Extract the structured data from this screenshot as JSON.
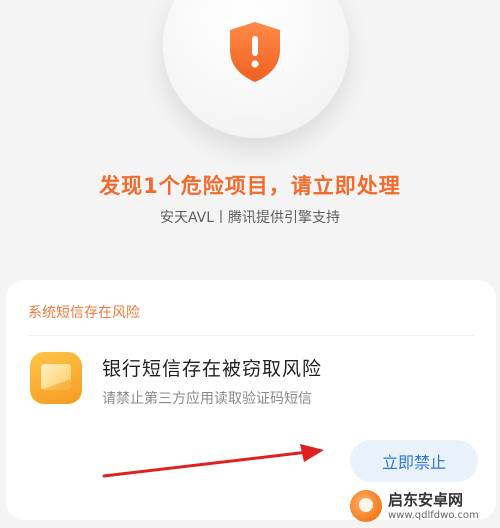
{
  "hero": {
    "icon": "warning-shield-icon",
    "headline": "发现1个危险项目，请立即处理",
    "subline": "安天AVL丨腾讯提供引擎支持"
  },
  "card": {
    "title": "系统短信存在风险",
    "risk_item": {
      "icon": "sms-app-icon",
      "title": "银行短信存在被窃取风险",
      "description": "请禁止第三方应用读取验证码短信"
    },
    "action_label": "立即禁止"
  },
  "colors": {
    "accent_orange": "#f26a2c",
    "action_blue": "#2f77d8",
    "action_bg": "#e9f2fb",
    "arrow_red": "#e02020"
  },
  "watermark": {
    "name": "启东安卓网",
    "url": "www.qdlfdwo.com"
  }
}
